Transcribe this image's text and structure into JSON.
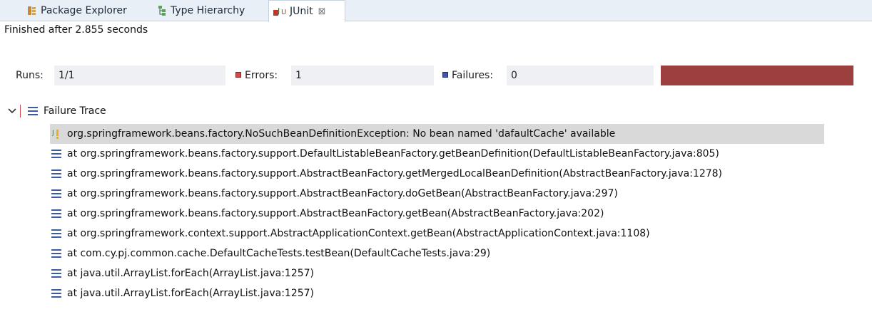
{
  "tabs": [
    {
      "label": "Package Explorer",
      "icon": "package-icon"
    },
    {
      "label": "Type Hierarchy",
      "icon": "hierarchy-icon"
    },
    {
      "label": "JUnit",
      "icon": "junit-icon",
      "active": true,
      "close": "⊠"
    }
  ],
  "status": "Finished after 2.855 seconds",
  "counters": {
    "runs_label": "Runs:",
    "runs_value": "1/1",
    "errors_label": "Errors:",
    "errors_value": "1",
    "failures_label": "Failures:",
    "failures_value": "0",
    "progress_color": "#9e3f3f"
  },
  "trace": {
    "header": "Failure Trace",
    "lines": [
      "org.springframework.beans.factory.NoSuchBeanDefinitionException: No bean named 'dafaultCache' available",
      "at org.springframework.beans.factory.support.DefaultListableBeanFactory.getBeanDefinition(DefaultListableBeanFactory.java:805)",
      "at org.springframework.beans.factory.support.AbstractBeanFactory.getMergedLocalBeanDefinition(AbstractBeanFactory.java:1278)",
      "at org.springframework.beans.factory.support.AbstractBeanFactory.doGetBean(AbstractBeanFactory.java:297)",
      "at org.springframework.beans.factory.support.AbstractBeanFactory.getBean(AbstractBeanFactory.java:202)",
      "at org.springframework.context.support.AbstractApplicationContext.getBean(AbstractApplicationContext.java:1108)",
      "at com.cy.pj.common.cache.DefaultCacheTests.testBean(DefaultCacheTests.java:29)",
      "at java.util.ArrayList.forEach(ArrayList.java:1257)",
      "at java.util.ArrayList.forEach(ArrayList.java:1257)"
    ]
  }
}
